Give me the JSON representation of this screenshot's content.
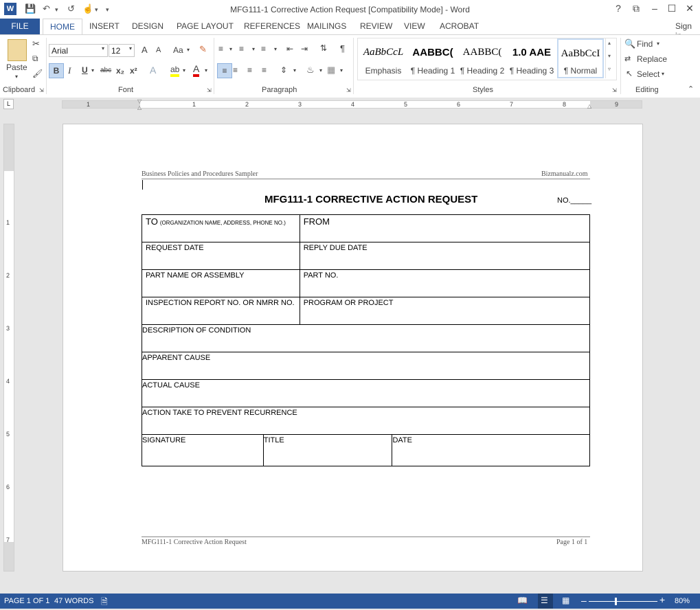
{
  "window": {
    "title": "MFG111-1 Corrective Action Request [Compatibility Mode] - Word",
    "controls": [
      "?",
      "⧉",
      "–",
      "☐",
      "✕"
    ]
  },
  "tabs": {
    "file": "FILE",
    "items": [
      "HOME",
      "INSERT",
      "DESIGN",
      "PAGE LAYOUT",
      "REFERENCES",
      "MAILINGS",
      "REVIEW",
      "VIEW",
      "ACROBAT"
    ],
    "signin": "Sign in"
  },
  "ribbon": {
    "clipboard": {
      "paste": "Paste",
      "label": "Clipboard"
    },
    "font": {
      "name": "Arial",
      "size": "12",
      "label": "Font",
      "bold": "B",
      "italic": "I",
      "underline": "U",
      "strike": "abc",
      "subscript": "x₂",
      "superscript": "x²",
      "grow": "A",
      "shrink": "A",
      "case": "Aa"
    },
    "paragraph": {
      "label": "Paragraph"
    },
    "styles": {
      "label": "Styles",
      "items": [
        {
          "sample": "AaBbCcL",
          "name": "Emphasis"
        },
        {
          "sample": "AABBC(",
          "name": "¶ Heading 1"
        },
        {
          "sample": "AABBC(",
          "name": "¶ Heading 2"
        },
        {
          "sample": "1.0  AAE",
          "name": "¶ Heading 3"
        },
        {
          "sample": "AaBbCcI",
          "name": "¶ Normal"
        }
      ]
    },
    "editing": {
      "label": "Editing",
      "find": "Find",
      "replace": "Replace",
      "select": "Select"
    }
  },
  "ruler": {
    "numbers": [
      "1",
      "1",
      "2",
      "3",
      "4",
      "5",
      "6",
      "7",
      "8",
      "9"
    ],
    "vnumbers": [
      "1",
      "2",
      "3",
      "4",
      "5",
      "6",
      "7"
    ]
  },
  "document": {
    "header_left": "Business Policies and Procedures Sampler",
    "header_right": "Bizmanualz.com",
    "title": "MFG111-1 CORRECTIVE ACTION REQUEST",
    "no_label": "NO._____",
    "form": {
      "to": "TO",
      "to_note": "(ORGANIZATION NAME, ADDRESS, PHONE NO.)",
      "from": "FROM",
      "request_date": "REQUEST DATE",
      "reply_due_date": "REPLY DUE DATE",
      "part_name": "PART NAME OR ASSEMBLY",
      "part_no": "PART NO.",
      "inspection": "INSPECTION REPORT NO. OR NMRR NO.",
      "program": "PROGRAM OR PROJECT",
      "description": "DESCRIPTION OF CONDITION",
      "apparent": "APPARENT CAUSE",
      "actual": "ACTUAL CAUSE",
      "action": "ACTION TAKE TO PREVENT RECURRENCE",
      "signature": "SIGNATURE",
      "sig_title": "TITLE",
      "date": "DATE"
    },
    "footer_left": "MFG111-1 Corrective Action Request",
    "footer_right": "Page 1 of 1"
  },
  "status": {
    "page": "PAGE 1 OF 1",
    "words": "47 WORDS",
    "zoom": "80%",
    "zoom_minus": "–",
    "zoom_plus": "+"
  },
  "colors": {
    "accent": "#2b579a"
  }
}
